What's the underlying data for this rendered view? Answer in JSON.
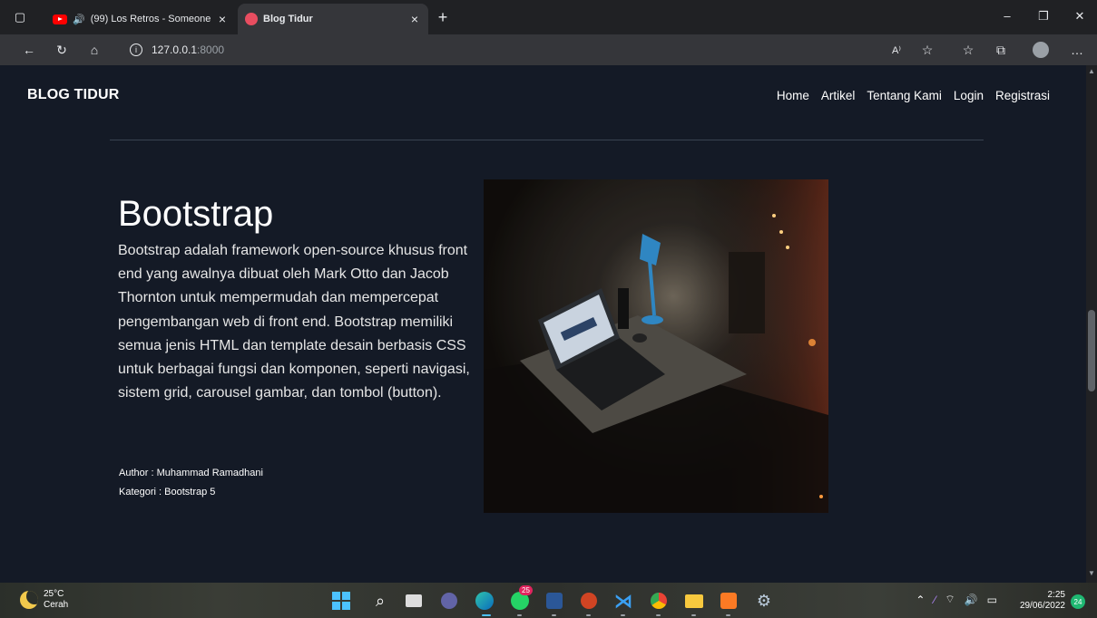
{
  "browser": {
    "tabs": [
      {
        "label": "(99) Los Retros - Someone",
        "icon": "youtube-icon"
      },
      {
        "label": "Blog Tidur",
        "icon": "blog-favicon"
      }
    ],
    "url_host": "127.0.0.1",
    "url_port": ":8000"
  },
  "page": {
    "brand": "BLOG TIDUR",
    "nav": [
      "Home",
      "Artikel",
      "Tentang Kami",
      "Login",
      "Registrasi"
    ],
    "article": {
      "title": "Bootstrap",
      "body": "Bootstrap adalah framework open-source khusus front end yang awalnya dibuat oleh Mark Otto dan Jacob Thornton untuk mempermudah dan mempercepat pengembangan web di front end. Bootstrap memiliki semua jenis HTML dan template desain berbasis CSS untuk berbagai fungsi dan komponen, seperti navigasi, sistem grid, carousel gambar, dan tombol (button).",
      "author": "Author : Muhammad Ramadhani",
      "category": "Kategori : Bootstrap 5"
    }
  },
  "taskbar": {
    "weather_temp": "25°C",
    "weather_desc": "Cerah",
    "whatsapp_badge": "25",
    "time": "2:25",
    "date": "29/06/2022",
    "notifications": "24"
  },
  "colors": {
    "page_bg": "#141a26",
    "accent": "#1fb872"
  }
}
